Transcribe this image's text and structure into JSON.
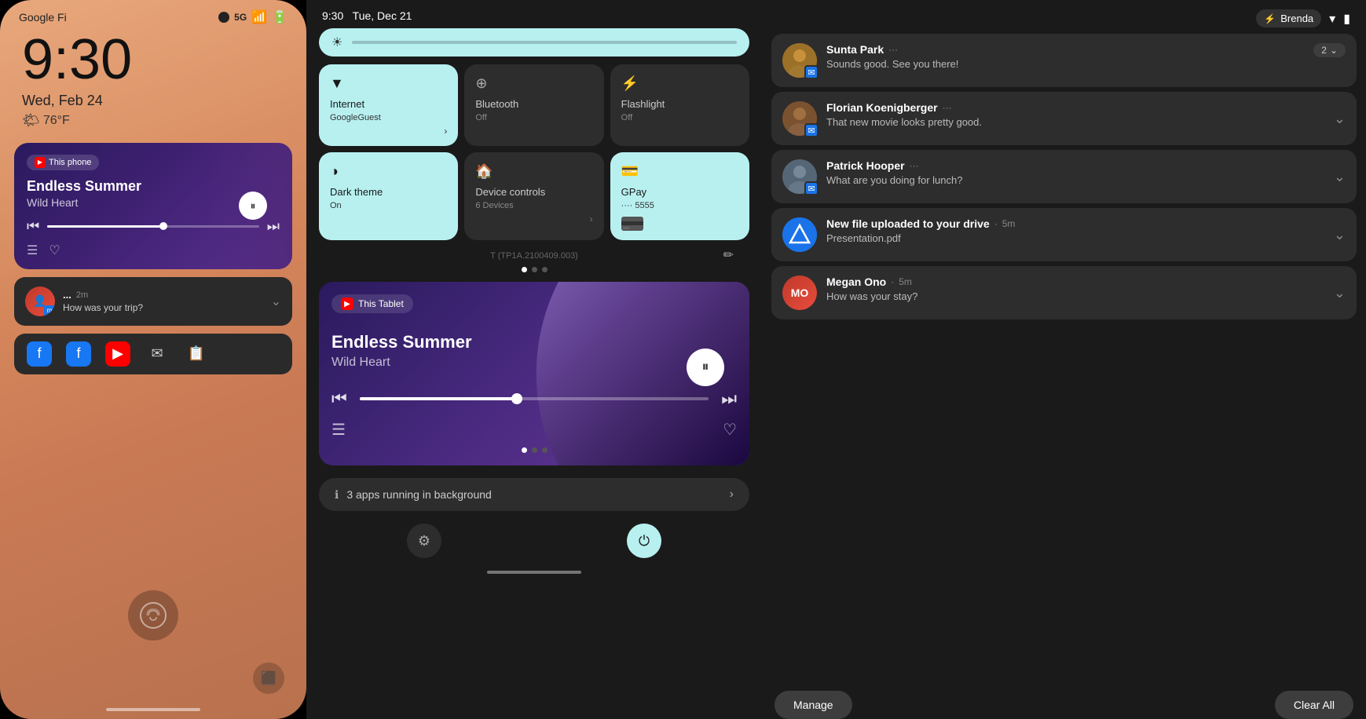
{
  "phone": {
    "carrier": "Google Fi",
    "signal": "5G",
    "time": "9:30",
    "date": "Wed, Feb 24",
    "weather_icon": "🌤",
    "weather": "76°F",
    "music": {
      "app_icon": "▶",
      "badge_label": "This phone",
      "title": "Endless Summer",
      "artist": "Wild Heart",
      "progress": 55
    },
    "notification": {
      "name": "...",
      "time": "2m",
      "message": "How was your trip?"
    },
    "fingerprint_icon": "⊛",
    "recent_icon": "⬛"
  },
  "tablet": {
    "time": "9:30",
    "date": "Tue, Dec 21",
    "quick_settings": {
      "tiles": [
        {
          "icon": "▼",
          "label": "Internet",
          "sub": "GoogleGuest",
          "active": true,
          "arrow": "›"
        },
        {
          "icon": "⊕",
          "label": "Bluetooth",
          "sub": "Off",
          "active": false,
          "arrow": ""
        },
        {
          "icon": "⚡",
          "label": "Flashlight",
          "sub": "Off",
          "active": false,
          "arrow": ""
        },
        {
          "icon": "◑",
          "label": "Dark theme",
          "sub": "On",
          "active": true,
          "arrow": ""
        },
        {
          "icon": "🏠",
          "label": "Device controls",
          "sub": "6 Devices",
          "active": false,
          "arrow": "›"
        },
        {
          "icon": "💳",
          "label": "GPay",
          "sub": "···· 5555",
          "active": true,
          "arrow": ""
        }
      ]
    },
    "build": "T (TP1A.2100409.003)",
    "music": {
      "badge_label": "This Tablet",
      "title": "Endless Summer",
      "artist": "Wild Heart"
    },
    "bg_apps": "3 apps running in background",
    "dots": [
      "active",
      "inactive",
      "inactive"
    ]
  },
  "notifications": {
    "status": {
      "user": "Brenda",
      "user_icon": "⚡"
    },
    "items": [
      {
        "name": "Sunta Park",
        "time": "",
        "message": "Sounds good. See you there!",
        "avatar_type": "sunta",
        "app_badge": "blue",
        "expand_count": "2"
      },
      {
        "name": "Florian Koenigberger",
        "time": "",
        "message": "That new movie looks pretty good.",
        "avatar_type": "florian",
        "app_badge": "blue"
      },
      {
        "name": "Patrick Hooper",
        "time": "",
        "message": "What are you doing for lunch?",
        "avatar_type": "patrick",
        "app_badge": "blue"
      },
      {
        "name": "New file uploaded to your drive",
        "time": "5m",
        "message": "Presentation.pdf",
        "avatar_type": "drive",
        "app_badge": ""
      },
      {
        "name": "Megan Ono",
        "time": "5m",
        "message": "How was your stay?",
        "avatar_type": "megan",
        "app_badge": ""
      }
    ],
    "manage_label": "Manage",
    "clear_all_label": "Clear All"
  }
}
